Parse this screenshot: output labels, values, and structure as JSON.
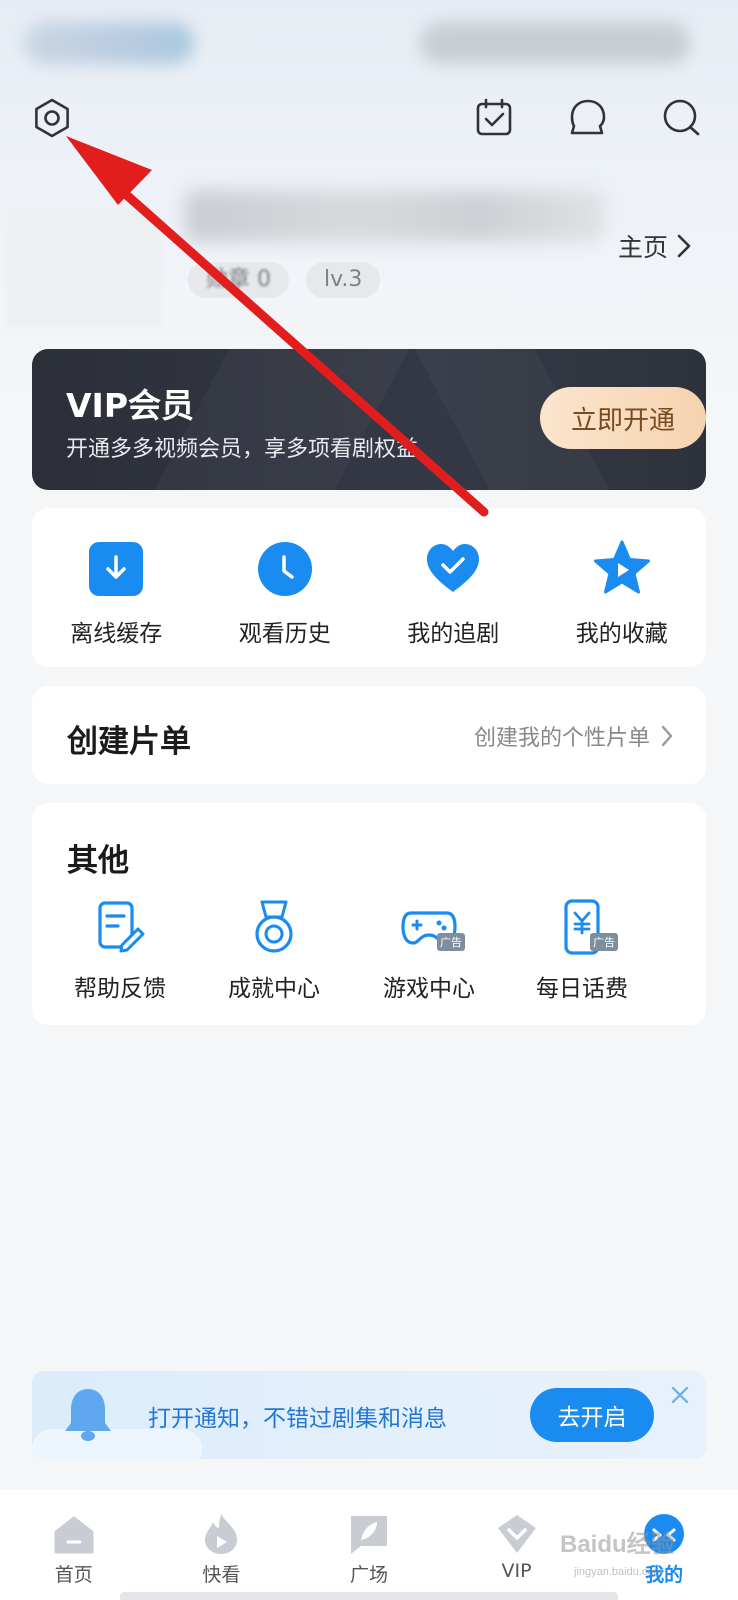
{
  "header": {
    "settings_icon": "settings-hexagon-icon",
    "checkin_icon": "calendar-check-icon",
    "messages_icon": "message-bubble-icon",
    "search_icon": "search-icon"
  },
  "profile": {
    "homepage_label": "主页",
    "medal_badge": "勋章 0",
    "level_badge": "lv.3"
  },
  "vip": {
    "title": "VIP会员",
    "subtitle": "开通多多视频会员，享多项看剧权益",
    "button": "立即开通"
  },
  "quick_actions": [
    {
      "label": "离线缓存",
      "icon": "download-icon"
    },
    {
      "label": "观看历史",
      "icon": "clock-icon"
    },
    {
      "label": "我的追剧",
      "icon": "heart-icon"
    },
    {
      "label": "我的收藏",
      "icon": "star-icon"
    }
  ],
  "playlist": {
    "title": "创建片单",
    "link": "创建我的个性片单"
  },
  "other": {
    "title": "其他",
    "items": [
      {
        "label": "帮助反馈",
        "icon": "feedback-edit-icon"
      },
      {
        "label": "成就中心",
        "icon": "medal-icon"
      },
      {
        "label": "游戏中心",
        "icon": "gamepad-icon",
        "ad": "广告"
      },
      {
        "label": "每日话费",
        "icon": "phone-yuan-icon",
        "ad": "广告"
      }
    ]
  },
  "notification": {
    "text": "打开通知，不错过剧集和消息",
    "button": "去开启"
  },
  "tabbar": [
    {
      "label": "首页",
      "icon": "home-icon"
    },
    {
      "label": "快看",
      "icon": "play-flame-icon"
    },
    {
      "label": "广场",
      "icon": "square-leaf-icon"
    },
    {
      "label": "VIP",
      "icon": "vip-diamond-icon"
    },
    {
      "label": "我的",
      "icon": "mine-face-icon",
      "active": true
    }
  ],
  "watermark": {
    "main": "Baidu经验",
    "sub": "jingyan.baidu.com"
  },
  "colors": {
    "accent": "#1a8bf0",
    "annotation_arrow": "#e11d1d",
    "vip_card": "#2f333d",
    "vip_button": "#f8dcbf"
  }
}
